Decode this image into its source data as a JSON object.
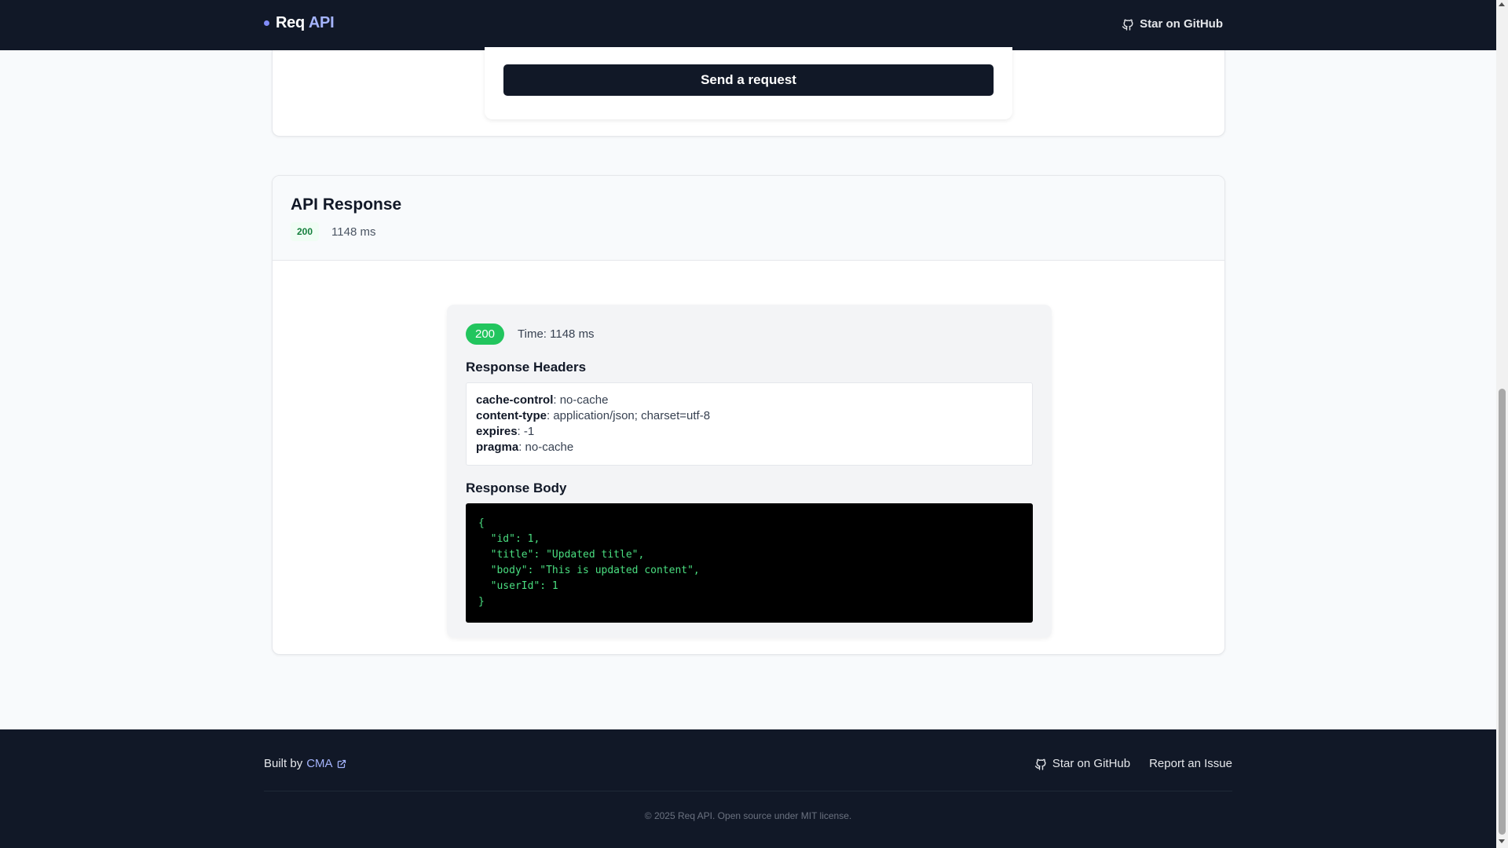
{
  "header": {
    "brand_primary": "Req",
    "brand_accent": "API",
    "github_label": "Star on GitHub"
  },
  "request": {
    "send_label": "Send a request"
  },
  "response": {
    "title": "API Response",
    "status_code": "200",
    "duration": "1148 ms",
    "panel": {
      "status_code": "200",
      "time_label": "Time: 1148 ms",
      "headers_title": "Response Headers",
      "headers": [
        {
          "key": "cache-control",
          "value": "no-cache"
        },
        {
          "key": "content-type",
          "value": "application/json; charset=utf-8"
        },
        {
          "key": "expires",
          "value": "-1"
        },
        {
          "key": "pragma",
          "value": "no-cache"
        }
      ],
      "body_title": "Response Body",
      "body_lines": [
        "{",
        "  \"id\": 1,",
        "  \"title\": \"Updated title\",",
        "  \"body\": \"This is updated content\",",
        "  \"userId\": 1",
        "}"
      ]
    }
  },
  "footer": {
    "built_by": "Built by",
    "author": "CMA",
    "github_label": "Star on GitHub",
    "report_label": "Report an Issue",
    "copyright": "© 2025 Req API. Open source under MIT license."
  },
  "colors": {
    "nav_bg": "#111827",
    "accent": "#a5b4fc",
    "success": "#22c55e",
    "code_text": "#4ade80"
  },
  "icons": [
    "github-icon",
    "external-link-icon"
  ]
}
